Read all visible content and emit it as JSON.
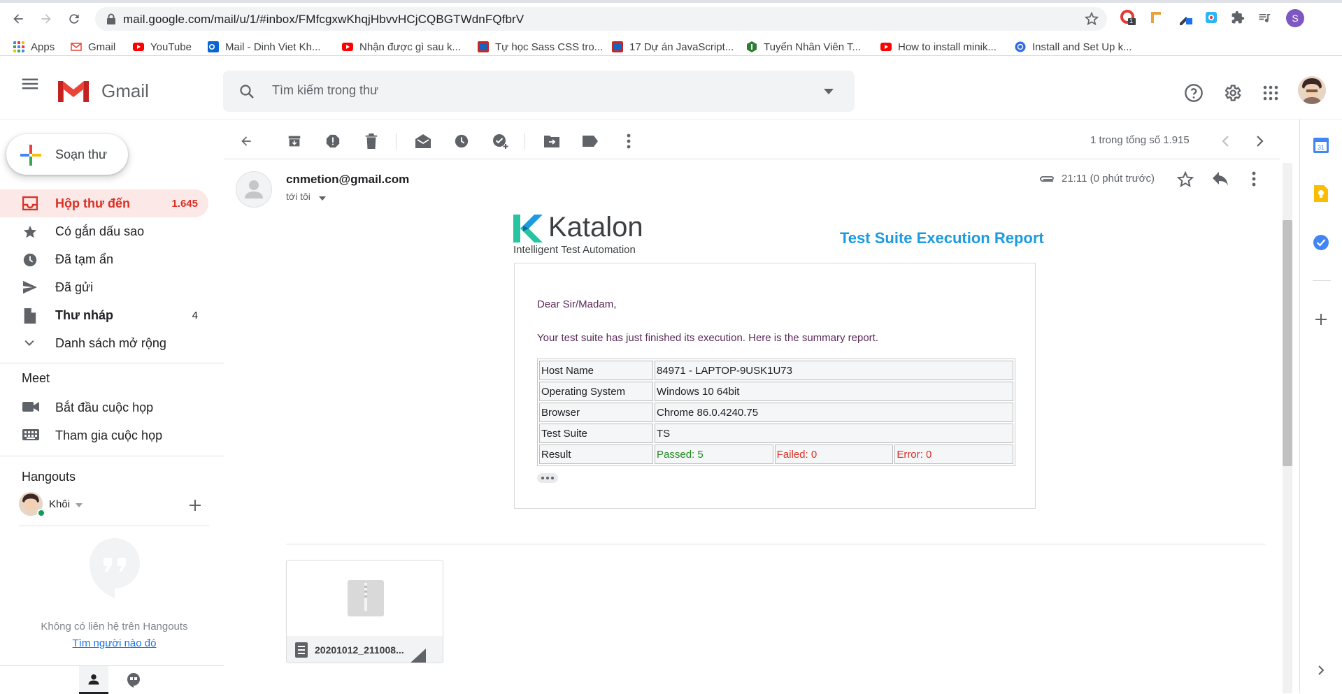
{
  "browser": {
    "url": "mail.google.com/mail/u/1/#inbox/FMfcgxwKhqjHbvvHCjCQBGTWdnFQfbrV",
    "profile_initial": "S",
    "extension_badge": "1",
    "bookmarks": [
      {
        "label": "Apps",
        "icon": "apps-grid-icon"
      },
      {
        "label": "Gmail",
        "icon": "gmail-icon"
      },
      {
        "label": "YouTube",
        "icon": "youtube-icon"
      },
      {
        "label": "Mail - Dinh Viet Kh...",
        "icon": "outlook-icon"
      },
      {
        "label": "Nhận được gì sau k...",
        "icon": "youtube-icon"
      },
      {
        "label": "Tự học Sass CSS tro...",
        "icon": "site-icon"
      },
      {
        "label": "17 Dự án JavaScript...",
        "icon": "site-icon"
      },
      {
        "label": "Tuyển Nhân Viên T...",
        "icon": "site-icon"
      },
      {
        "label": "How to install minik...",
        "icon": "youtube-icon"
      },
      {
        "label": "Install and Set Up k...",
        "icon": "kubernetes-icon"
      }
    ]
  },
  "gmail": {
    "logo_text": "Gmail",
    "search_placeholder": "Tìm kiếm trong thư",
    "compose_label": "Soạn thư",
    "nav": [
      {
        "label": "Hộp thư đến",
        "count": "1.645",
        "active": true
      },
      {
        "label": "Có gắn dấu sao",
        "count": ""
      },
      {
        "label": "Đã tạm ẩn",
        "count": ""
      },
      {
        "label": "Đã gửi",
        "count": ""
      },
      {
        "label": "Thư nháp",
        "count": "4"
      },
      {
        "label": "Danh sách mở rộng",
        "count": ""
      }
    ],
    "meet": {
      "title": "Meet",
      "start": "Bắt đầu cuộc họp",
      "join": "Tham gia cuộc họp"
    },
    "hangouts": {
      "title": "Hangouts",
      "user": "Khôi",
      "empty_text": "Không có liên hệ trên Hangouts",
      "find_link": "Tìm người nào đó"
    },
    "pager": "1 trong tổng số 1.915"
  },
  "email": {
    "sender": "cnmetion@gmail.com",
    "to": "tới tôi",
    "time": "21:11 (0 phút trước)",
    "brand": "Katalon",
    "brand_tagline": "Intelligent Test Automation",
    "report_title": "Test Suite Execution Report",
    "greeting": "Dear Sir/Madam,",
    "intro": "Your test suite has just finished its execution. Here is the summary report.",
    "summary": {
      "host_label": "Host Name",
      "host_value": "84971 - LAPTOP-9USK1U73",
      "os_label": "Operating System",
      "os_value": "Windows 10 64bit",
      "browser_label": "Browser",
      "browser_value": "Chrome 86.0.4240.75",
      "suite_label": "Test Suite",
      "suite_value": "TS",
      "result_label": "Result",
      "passed": "Passed: 5",
      "failed": "Failed: 0",
      "error": "Error: 0"
    },
    "attachment_name": "20201012_211008..."
  },
  "colors": {
    "gmail_red": "#d93025",
    "active_bg": "#fce8e6",
    "katalon_blue": "#1c9be0",
    "pass_green": "#1e8a1e"
  }
}
